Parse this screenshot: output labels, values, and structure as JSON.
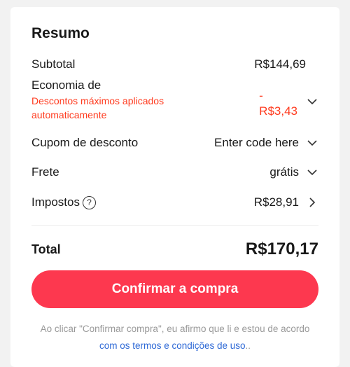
{
  "summary": {
    "title": "Resumo",
    "subtotal_label": "Subtotal",
    "subtotal_value": "R$144,69",
    "savings_label": "Economia de",
    "savings_note": "Descontos máximos aplicados automaticamente",
    "savings_sign": "-",
    "savings_value": "R$3,43",
    "coupon_label": "Cupom de desconto",
    "coupon_value": "Enter code here",
    "shipping_label": "Frete",
    "shipping_value": "grátis",
    "taxes_label": "Impostos",
    "taxes_help": "?",
    "taxes_value": "R$28,91",
    "total_label": "Total",
    "total_value": "R$170,17"
  },
  "actions": {
    "confirm_label": "Confirmar a compra"
  },
  "legal": {
    "text": "Ao clicar \"Confirmar compra\", eu afirmo que li e estou de acordo ",
    "link": "com os termos e condições de uso",
    "suffix": ".."
  },
  "colors": {
    "accent": "#fd384f",
    "discount": "#ff3b1f",
    "link": "#2e69d6",
    "muted": "#999999"
  }
}
